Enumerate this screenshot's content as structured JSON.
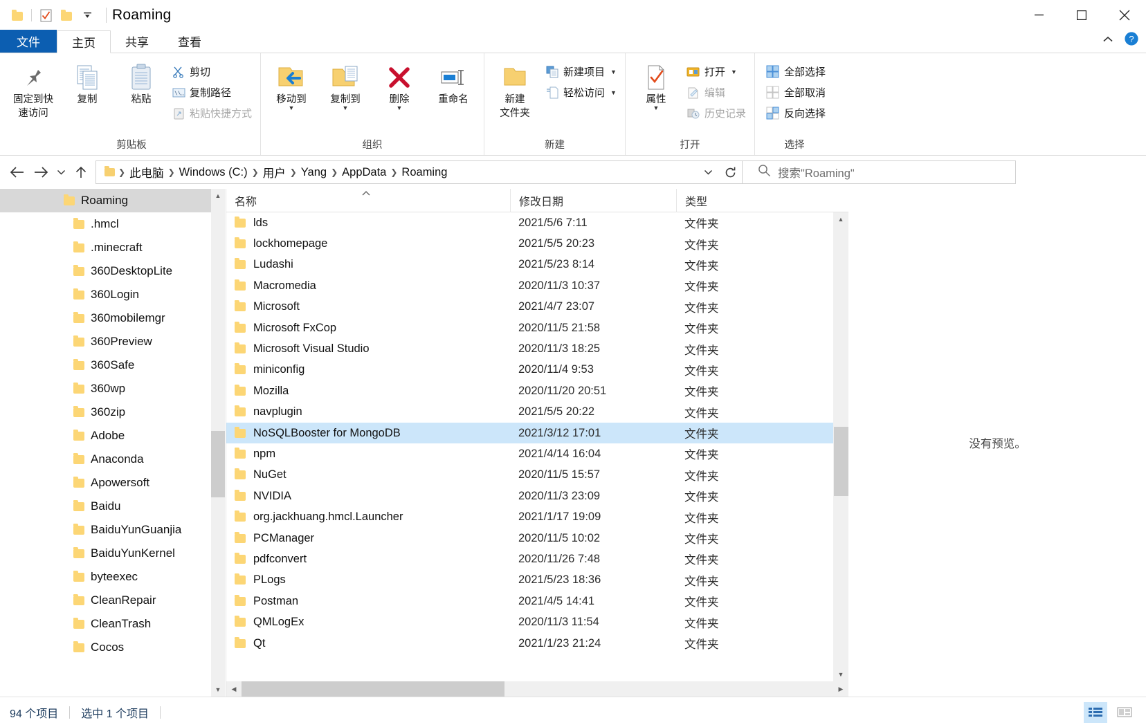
{
  "window": {
    "title": "Roaming",
    "quick_access": [
      "folder-icon",
      "properties-check-icon",
      "new-folder-icon"
    ],
    "controls": {
      "minimize": "minimize-icon",
      "maximize": "maximize-icon",
      "close": "close-icon"
    }
  },
  "tabs": [
    {
      "label": "文件",
      "name": "tab-file"
    },
    {
      "label": "主页",
      "name": "tab-home"
    },
    {
      "label": "共享",
      "name": "tab-share"
    },
    {
      "label": "查看",
      "name": "tab-view"
    }
  ],
  "ribbon": {
    "groups": [
      {
        "label": "剪贴板",
        "big": [
          {
            "label_line1": "固定到快",
            "label_line2": "速访问",
            "icon": "pin-icon"
          },
          {
            "label_line1": "复制",
            "label_line2": "",
            "icon": "copy-icon"
          },
          {
            "label_line1": "粘贴",
            "label_line2": "",
            "icon": "paste-icon"
          }
        ],
        "small": [
          {
            "label": "剪切",
            "icon": "scissors-icon",
            "disabled": false
          },
          {
            "label": "复制路径",
            "icon": "copy-path-icon",
            "disabled": false
          },
          {
            "label": "粘贴快捷方式",
            "icon": "paste-shortcut-icon",
            "disabled": true
          }
        ]
      },
      {
        "label": "组织",
        "big": [
          {
            "label_line1": "移动到",
            "label_line2": "",
            "icon": "move-to-icon",
            "caret": true
          },
          {
            "label_line1": "复制到",
            "label_line2": "",
            "icon": "copy-to-icon",
            "caret": true
          },
          {
            "label_line1": "删除",
            "label_line2": "",
            "icon": "delete-icon",
            "caret": true
          },
          {
            "label_line1": "重命名",
            "label_line2": "",
            "icon": "rename-icon"
          }
        ],
        "small": []
      },
      {
        "label": "新建",
        "big": [
          {
            "label_line1": "新建",
            "label_line2": "文件夹",
            "icon": "new-folder-icon"
          }
        ],
        "small": [
          {
            "label": "新建项目",
            "icon": "new-item-icon",
            "caret": true,
            "disabled": false
          },
          {
            "label": "轻松访问",
            "icon": "easy-access-icon",
            "caret": true,
            "disabled": false
          }
        ]
      },
      {
        "label": "打开",
        "big": [
          {
            "label_line1": "属性",
            "label_line2": "",
            "icon": "properties-icon",
            "caret": true
          }
        ],
        "small": [
          {
            "label": "打开",
            "icon": "open-icon",
            "caret": true,
            "disabled": false
          },
          {
            "label": "编辑",
            "icon": "edit-icon",
            "disabled": true
          },
          {
            "label": "历史记录",
            "icon": "history-icon",
            "disabled": true
          }
        ]
      },
      {
        "label": "选择",
        "big": [],
        "small": [
          {
            "label": "全部选择",
            "icon": "select-all-icon",
            "disabled": false
          },
          {
            "label": "全部取消",
            "icon": "select-none-icon",
            "disabled": false
          },
          {
            "label": "反向选择",
            "icon": "invert-selection-icon",
            "disabled": false
          }
        ]
      }
    ]
  },
  "addressbar": {
    "back": "back-arrow-icon",
    "forward": "forward-arrow-icon",
    "recent": "chevron-down-icon",
    "up": "up-arrow-icon",
    "crumbs": [
      "此电脑",
      "Windows (C:)",
      "用户",
      "Yang",
      "AppData",
      "Roaming"
    ],
    "dropdown": "chevron-down-icon",
    "refresh": "refresh-icon"
  },
  "search": {
    "icon": "search-icon",
    "placeholder": "搜索\"Roaming\""
  },
  "navpane": {
    "root": {
      "label": "Roaming",
      "selected": true
    },
    "items": [
      {
        "label": ".hmcl"
      },
      {
        "label": ".minecraft"
      },
      {
        "label": "360DesktopLite"
      },
      {
        "label": "360Login"
      },
      {
        "label": "360mobilemgr"
      },
      {
        "label": "360Preview"
      },
      {
        "label": "360Safe"
      },
      {
        "label": "360wp"
      },
      {
        "label": "360zip"
      },
      {
        "label": "Adobe"
      },
      {
        "label": "Anaconda"
      },
      {
        "label": "Apowersoft"
      },
      {
        "label": "Baidu"
      },
      {
        "label": "BaiduYunGuanjia"
      },
      {
        "label": "BaiduYunKernel"
      },
      {
        "label": "byteexec"
      },
      {
        "label": "CleanRepair"
      },
      {
        "label": "CleanTrash"
      },
      {
        "label": "Cocos"
      }
    ]
  },
  "filelist": {
    "columns": [
      {
        "label": "名称",
        "name": "column-name"
      },
      {
        "label": "修改日期",
        "name": "column-date-modified"
      },
      {
        "label": "类型",
        "name": "column-type"
      }
    ],
    "sort_indicator": "sort-ascending-icon",
    "rows": [
      {
        "name": "lds",
        "date": "2021/5/6 7:11",
        "type": "文件夹",
        "selected": false
      },
      {
        "name": "lockhomepage",
        "date": "2021/5/5 20:23",
        "type": "文件夹",
        "selected": false
      },
      {
        "name": "Ludashi",
        "date": "2021/5/23 8:14",
        "type": "文件夹",
        "selected": false
      },
      {
        "name": "Macromedia",
        "date": "2020/11/3 10:37",
        "type": "文件夹",
        "selected": false
      },
      {
        "name": "Microsoft",
        "date": "2021/4/7 23:07",
        "type": "文件夹",
        "selected": false
      },
      {
        "name": "Microsoft FxCop",
        "date": "2020/11/5 21:58",
        "type": "文件夹",
        "selected": false
      },
      {
        "name": "Microsoft Visual Studio",
        "date": "2020/11/3 18:25",
        "type": "文件夹",
        "selected": false
      },
      {
        "name": "miniconfig",
        "date": "2020/11/4 9:53",
        "type": "文件夹",
        "selected": false
      },
      {
        "name": "Mozilla",
        "date": "2020/11/20 20:51",
        "type": "文件夹",
        "selected": false
      },
      {
        "name": "navplugin",
        "date": "2021/5/5 20:22",
        "type": "文件夹",
        "selected": false
      },
      {
        "name": "NoSQLBooster for MongoDB",
        "date": "2021/3/12 17:01",
        "type": "文件夹",
        "selected": true
      },
      {
        "name": "npm",
        "date": "2021/4/14 16:04",
        "type": "文件夹",
        "selected": false
      },
      {
        "name": "NuGet",
        "date": "2020/11/5 15:57",
        "type": "文件夹",
        "selected": false
      },
      {
        "name": "NVIDIA",
        "date": "2020/11/3 23:09",
        "type": "文件夹",
        "selected": false
      },
      {
        "name": "org.jackhuang.hmcl.Launcher",
        "date": "2021/1/17 19:09",
        "type": "文件夹",
        "selected": false
      },
      {
        "name": "PCManager",
        "date": "2020/11/5 10:02",
        "type": "文件夹",
        "selected": false
      },
      {
        "name": "pdfconvert",
        "date": "2020/11/26 7:48",
        "type": "文件夹",
        "selected": false
      },
      {
        "name": "PLogs",
        "date": "2021/5/23 18:36",
        "type": "文件夹",
        "selected": false
      },
      {
        "name": "Postman",
        "date": "2021/4/5 14:41",
        "type": "文件夹",
        "selected": false
      },
      {
        "name": "QMLogEx",
        "date": "2020/11/3 11:54",
        "type": "文件夹",
        "selected": false
      },
      {
        "name": "Qt",
        "date": "2021/1/23 21:24",
        "type": "文件夹",
        "selected": false
      }
    ]
  },
  "preview": {
    "message": "没有预览。"
  },
  "statusbar": {
    "item_count": "94 个项目",
    "selection": "选中 1 个项目",
    "views": [
      {
        "name": "details-view-button",
        "active": true
      },
      {
        "name": "large-icons-view-button",
        "active": false
      }
    ]
  },
  "colors": {
    "accent": "#0c5eb1",
    "selection": "#cce6fa",
    "tree_selection": "#d8d8d8",
    "folder": "#fcd675"
  }
}
